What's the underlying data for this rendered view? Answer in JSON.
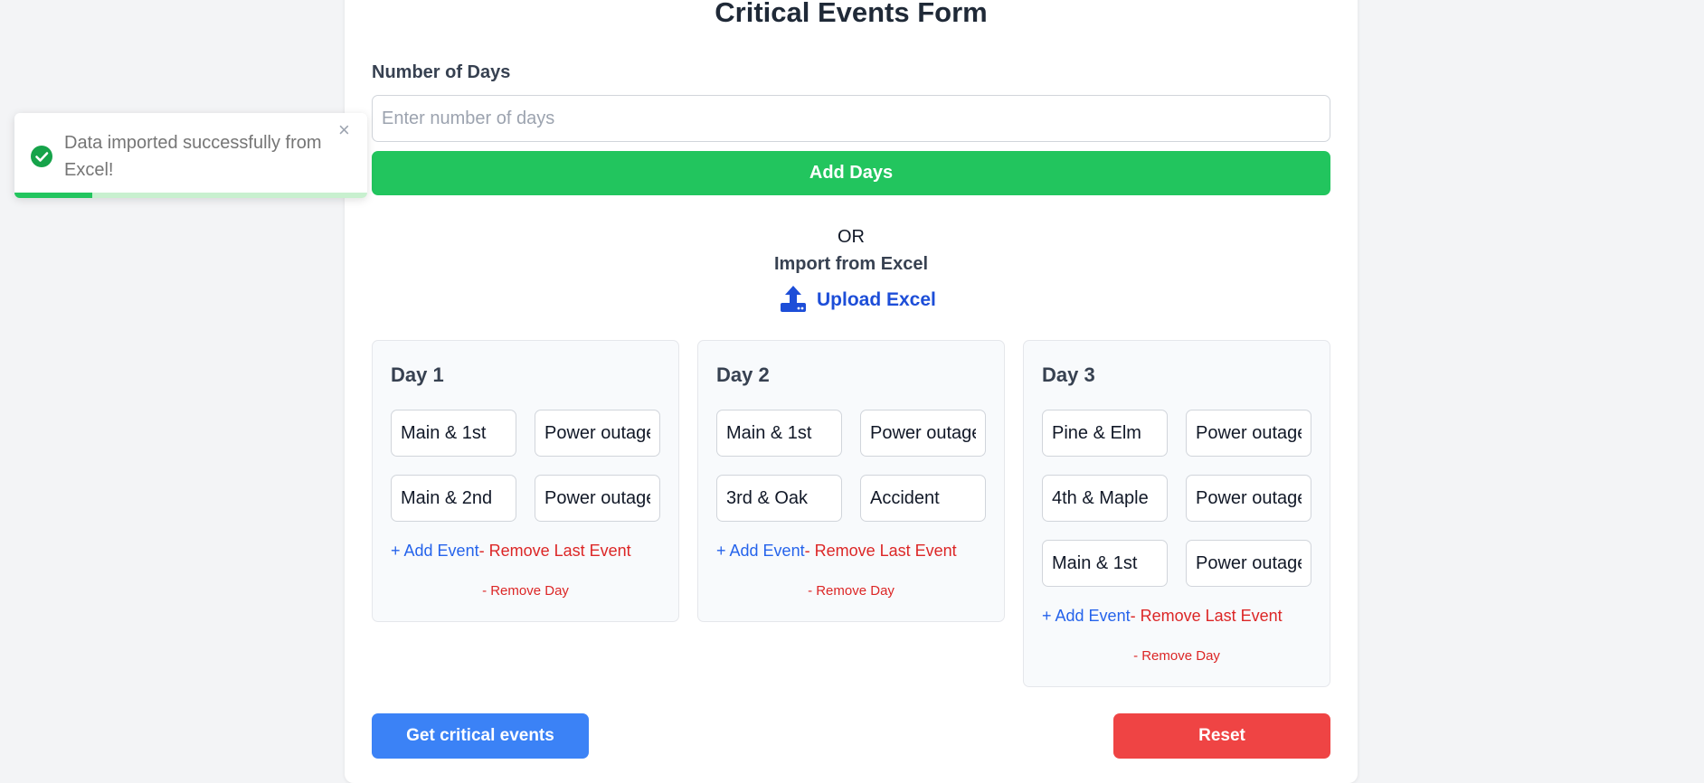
{
  "form": {
    "title": "Critical Events Form",
    "days_label": "Number of Days",
    "days_placeholder": "Enter number of days",
    "days_value": "",
    "add_days_label": "Add Days",
    "or_text": "OR",
    "import_label": "Import from Excel",
    "upload_label": "Upload Excel",
    "upload_icon": "upload-icon"
  },
  "days": [
    {
      "title": "Day 1",
      "events": [
        {
          "location": "Main & 1st",
          "description": "Power outage"
        },
        {
          "location": "Main & 2nd",
          "description": "Power outage"
        }
      ]
    },
    {
      "title": "Day 2",
      "events": [
        {
          "location": "Main & 1st",
          "description": "Power outage"
        },
        {
          "location": "3rd & Oak",
          "description": "Accident"
        }
      ]
    },
    {
      "title": "Day 3",
      "events": [
        {
          "location": "Pine & Elm",
          "description": "Power outage"
        },
        {
          "location": "4th & Maple",
          "description": "Power outage"
        },
        {
          "location": "Main & 1st",
          "description": "Power outage"
        }
      ]
    }
  ],
  "day_actions": {
    "add_event": "+ Add Event",
    "remove_last_event": "- Remove Last Event",
    "remove_day": "- Remove Day"
  },
  "actions": {
    "get_critical": "Get critical events",
    "reset": "Reset"
  },
  "toast": {
    "message": "Data imported successfully from Excel!",
    "close_symbol": "×",
    "icon": "check-circle-icon",
    "progress": 0.22
  },
  "colors": {
    "add_days": "#22c55e",
    "get_critical": "#3b82f6",
    "reset": "#ef4444",
    "link_blue": "#1d4ed8",
    "remove_red": "#dc2626"
  }
}
